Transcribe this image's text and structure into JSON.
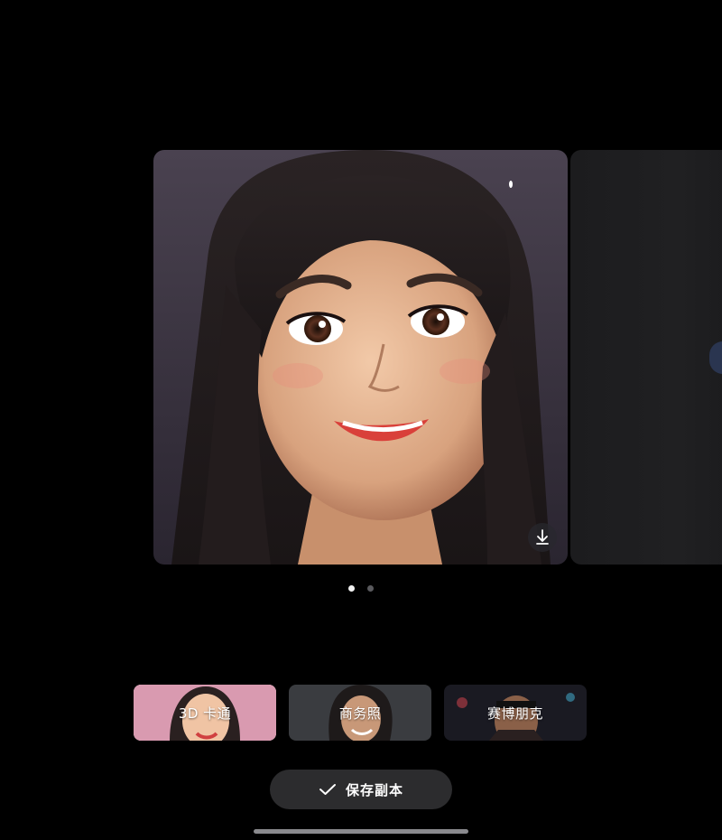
{
  "carousel": {
    "current_image": "3D cartoon portrait of smiling woman with long dark hair",
    "pages_total": 2,
    "current_page": 1,
    "download_icon": "download-icon"
  },
  "styles": [
    {
      "label": "3D 卡通",
      "selected": true
    },
    {
      "label": "商务照",
      "selected": false
    },
    {
      "label": "赛博朋克",
      "selected": false
    }
  ],
  "actions": {
    "save_label": "保存副本",
    "save_icon": "check-icon"
  },
  "colors": {
    "background": "#000000",
    "button_bg": "#2c2c2e",
    "selected_border": "#ffffff"
  }
}
